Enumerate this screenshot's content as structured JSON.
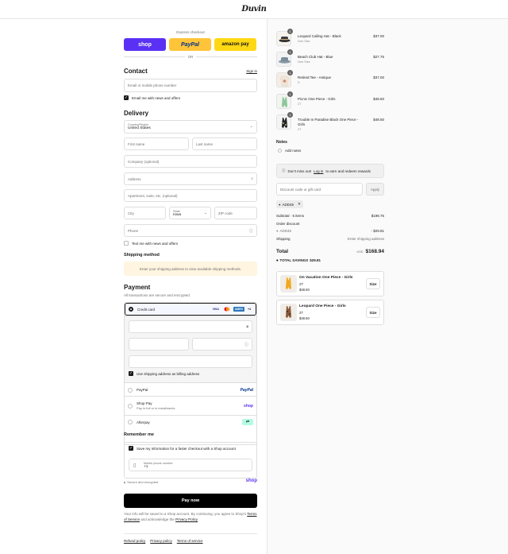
{
  "brand": {
    "logo_text": "Duvin"
  },
  "express": {
    "label": "Express checkout",
    "shop_label": "shop",
    "paypal_label": "PayPal",
    "amazon_label": "amazon pay",
    "or_label": "OR"
  },
  "contact": {
    "title": "Contact",
    "signin_label": "Sign in",
    "email_placeholder": "Email or mobile phone number",
    "news_label": "Email me with news and offers"
  },
  "delivery": {
    "title": "Delivery",
    "country_label": "Country/Region",
    "country_value": "United States",
    "first_name": "First name",
    "last_name": "Last name",
    "company": "Company (optional)",
    "address": "Address",
    "apartment": "Apartment, suite, etc. (optional)",
    "city": "City",
    "state_label": "State",
    "state_value": "Iowa",
    "zip": "ZIP code",
    "phone": "Phone",
    "text_label": "Text me with news and offers"
  },
  "shipping": {
    "title": "Shipping method",
    "notice": "Enter your shipping address to view available shipping methods."
  },
  "payment": {
    "title": "Payment",
    "subtitle": "All transactions are secure and encrypted.",
    "credit_card_label": "Credit card",
    "card_brands": [
      "VISA",
      "MC",
      "AMEX",
      "+4"
    ],
    "billing_label": "Use shipping address as billing address",
    "paypal_label": "PayPal",
    "paypal_logo": "PayPal",
    "shoppay_label": "Shop Pay",
    "shoppay_sub": "Pay in full or in installments",
    "shoppay_logo": "shop",
    "afterpay_label": "Afterpay"
  },
  "remember": {
    "title": "Remember me",
    "save_label": "Save my information for a faster checkout with a Shop account",
    "mobile_label": "Mobile phone number",
    "mobile_value": "+1",
    "secure_label": "Secure and encrypted",
    "shop_logo": "shop"
  },
  "pay_now_label": "Pay now",
  "legal": {
    "text_1": "Your info will be saved to a Shop account. By continuing, you agree to Shop's",
    "terms_link": "Terms of Service",
    "text_2": "and acknowledge the",
    "privacy_link": "Privacy Policy"
  },
  "footer": {
    "refund": "Refund policy",
    "privacy": "Privacy policy",
    "terms": "Terms of service"
  },
  "cart": {
    "items": [
      {
        "qty": "1",
        "name": "Leopard Calling Hat - Black",
        "variant": "One Size",
        "price": "$37.00"
      },
      {
        "qty": "1",
        "name": "Beach Club Hat - Blue",
        "variant": "One Size",
        "price": "$27.75"
      },
      {
        "qty": "1",
        "name": "Retired Tee - Antique",
        "variant": "S",
        "price": "$37.00"
      },
      {
        "qty": "1",
        "name": "Picnic One Piece - Girls",
        "variant": "2T",
        "price": "$48.50"
      },
      {
        "qty": "1",
        "name": "Trouble In Paradise Black One Piece - Girls",
        "variant": "2T",
        "price": "$48.50"
      }
    ],
    "notes_title": "Notes",
    "add_notes": "Add notes",
    "rewards_text_1": "Don't miss out!",
    "rewards_link": "Log in",
    "rewards_text_2": "to earn and redeem rewards",
    "discount_placeholder": "Discount code or gift card",
    "apply_label": "Apply",
    "code_tag": "ADD45",
    "subtotal_label": "Subtotal · 5 items",
    "subtotal_value": "$198.75",
    "order_discount_label": "Order discount",
    "discount_code": "ADD45",
    "discount_value": "- $29.81",
    "shipping_label": "Shipping",
    "shipping_value": "Enter shipping address",
    "total_label": "Total",
    "currency": "USD",
    "total_value": "$168.94",
    "savings_label": "TOTAL SAVINGS",
    "savings_value": "$29.81"
  },
  "upsell": [
    {
      "name": "On Vacation One Piece - Girls",
      "variant": "2T",
      "price": "$48.50",
      "button": "Size"
    },
    {
      "name": "Leopard One Piece - Girls",
      "variant": "2T",
      "price": "$48.50",
      "button": "Size"
    }
  ]
}
